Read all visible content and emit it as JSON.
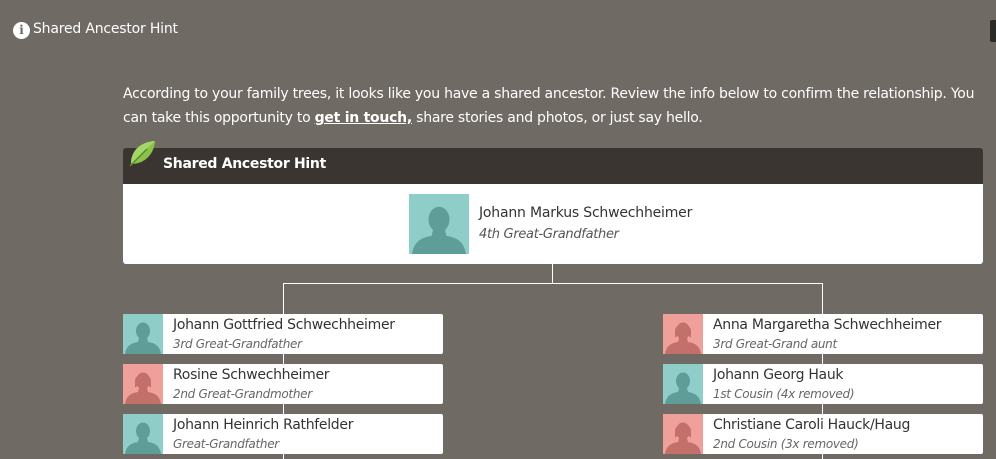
{
  "topbar": {
    "title": "Shared Ancestor Hint",
    "icon": "info-icon"
  },
  "intro": {
    "text_before": "According to your family trees, it looks like you have a shared ancestor. Review the info below to confirm the relationship. You can take this opportunity to ",
    "link": "get in touch,",
    "text_after": " share stories and photos, or just say hello."
  },
  "panel": {
    "title": "Shared Ancestor Hint",
    "ancestor": {
      "name": "Johann Markus Schwechheimer",
      "relation": "4th Great-Grandfather",
      "gender": "male"
    }
  },
  "left_branch": [
    {
      "name": "Johann Gottfried Schwechheimer",
      "relation": "3rd Great-Grandfather",
      "gender": "male"
    },
    {
      "name": "Rosine Schwechheimer",
      "relation": "2nd Great-Grandmother",
      "gender": "female"
    },
    {
      "name": "Johann Heinrich Rathfelder",
      "relation": "Great-Grandfather",
      "gender": "male"
    }
  ],
  "right_branch": [
    {
      "name": "Anna Margaretha Schwechheimer",
      "relation": "3rd Great-Grand aunt",
      "gender": "female"
    },
    {
      "name": "Johann Georg Hauk",
      "relation": "1st Cousin (4x removed)",
      "gender": "male"
    },
    {
      "name": "Christiane Caroli Hauck/Haug",
      "relation": "2nd Cousin (3x removed)",
      "gender": "female"
    }
  ],
  "colors": {
    "background": "#6f6a63",
    "header": "#3a3531",
    "male_avatar_bg": "#8ecdc8",
    "male_avatar_fg": "#5e9d98",
    "female_avatar_bg": "#f0a09a",
    "female_avatar_fg": "#c4706a",
    "leaf": "#8bc34a"
  }
}
